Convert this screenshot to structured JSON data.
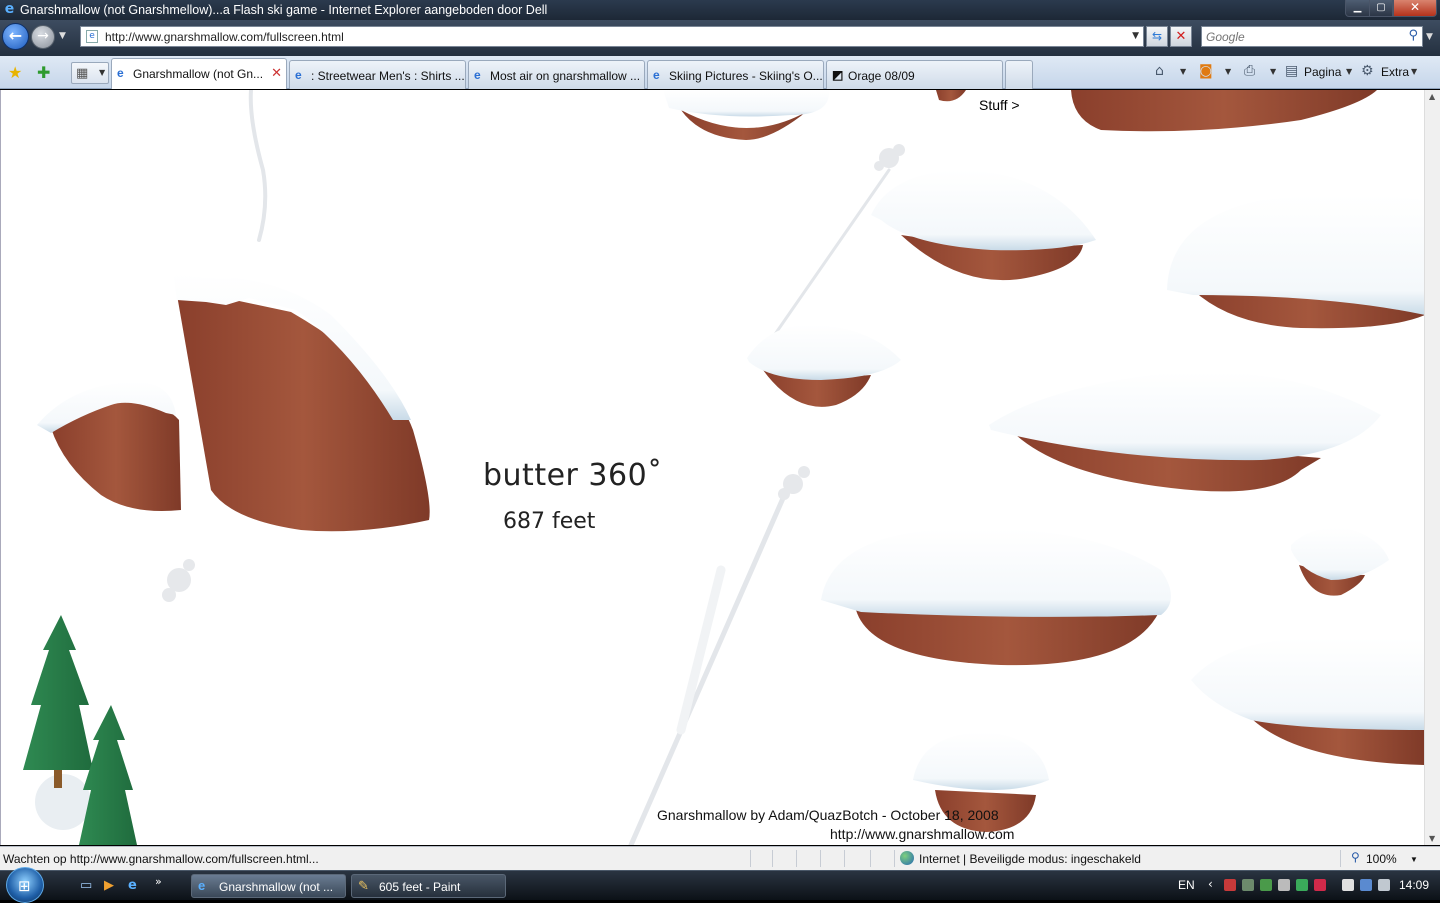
{
  "window": {
    "title": "Gnarshmallow (not Gnarshmellow)...a Flash ski game - Internet Explorer aangeboden door Dell",
    "minimize_icon": "minimize-icon",
    "maximize_icon": "maximize-icon",
    "close_icon": "close-icon"
  },
  "address_bar": {
    "url": "http://www.gnarshmallow.com/fullscreen.html",
    "search_placeholder": "Google"
  },
  "tabs": [
    {
      "label": "Gnarshmallow (not Gn...",
      "active": true,
      "icon": "ie-page-icon"
    },
    {
      "label": ": Streetwear Men's : Shirts ...",
      "active": false,
      "icon": "ie-page-icon"
    },
    {
      "label": "Most air on gnarshmallow ...",
      "active": false,
      "icon": "ie-page-icon"
    },
    {
      "label": "Skiing Pictures - Skiing's O...",
      "active": false,
      "icon": "ie-page-icon"
    },
    {
      "label": "Orage 08/09",
      "active": false,
      "icon": "orage-icon"
    }
  ],
  "command_bar": {
    "page_label": "Pagina",
    "tools_label": "Extra"
  },
  "game": {
    "trick_name": "butter 360˚",
    "distance": "687 feet",
    "stuff_link": "Stuff >",
    "credit": "Gnarshmallow  by Adam/QuazBotch - October 18, 2008",
    "credit_url": "http://www.gnarshmallow.com"
  },
  "status_bar": {
    "status_text": "Wachten op http://www.gnarshmallow.com/fullscreen.html...",
    "zone_text": "Internet | Beveiligde modus: ingeschakeld",
    "zoom": "100%"
  },
  "taskbar": {
    "tasks": [
      {
        "label": "Gnarshmallow (not ...",
        "icon": "ie-icon"
      },
      {
        "label": "605 feet - Paint",
        "icon": "paint-icon"
      }
    ],
    "language": "EN",
    "clock": "14:09"
  }
}
